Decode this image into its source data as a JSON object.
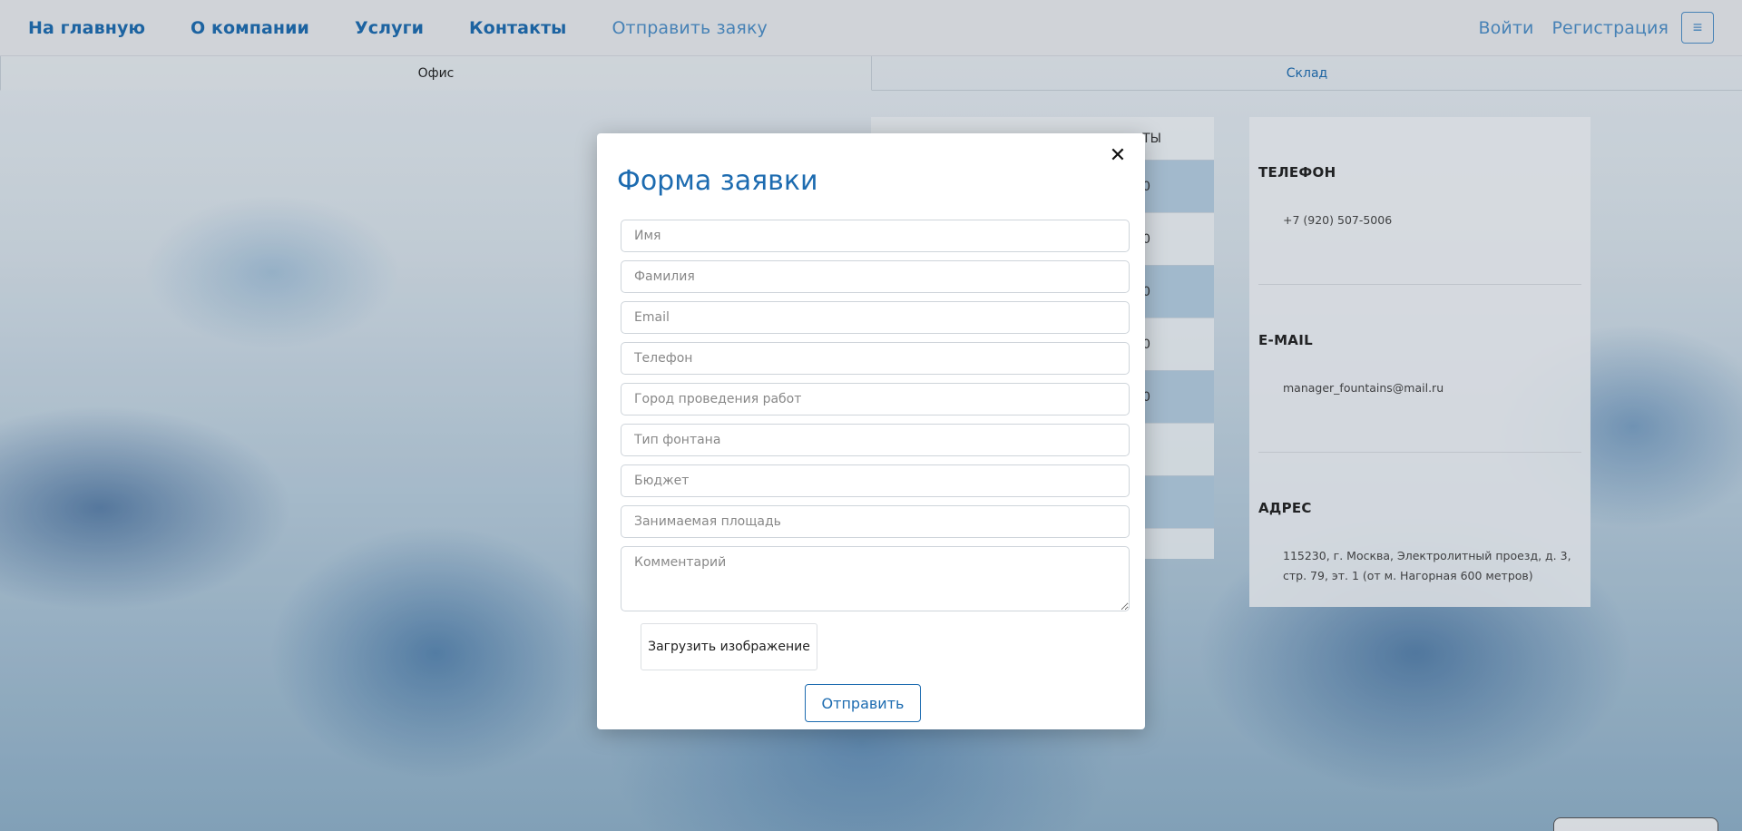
{
  "navbar": {
    "links": [
      "На главную",
      "О компании",
      "Услуги",
      "Контакты"
    ],
    "request_link": "Отправить заяку",
    "login": "Войти",
    "register": "Регистрация",
    "menu_icon": "≡"
  },
  "location_tabs": {
    "office": "Офис",
    "warehouse": "Склад"
  },
  "background_table": {
    "header_fragment": "ТЫ",
    "row_fragments": [
      "0",
      "0",
      "0",
      "0",
      "0",
      "",
      "",
      ""
    ]
  },
  "contacts": {
    "phone_heading": "ТЕЛЕФОН",
    "phone_value": "+7 (920) 507-5006",
    "email_heading": "E-MAIL",
    "email_value": "manager_fountains@mail.ru",
    "address_heading": "АДРЕС",
    "address_value": "115230, г. Москва, Электролитный проезд, д. 3, стр. 79, эт. 1 (от м. Нагорная 600 метров)"
  },
  "modal": {
    "title": "Форма заявки",
    "close_icon": "✕",
    "placeholders": {
      "first_name": "Имя",
      "last_name": "Фамилия",
      "email": "Email",
      "phone": "Телефон",
      "city": "Город проведения работ",
      "fountain_type": "Тип фонтана",
      "budget": "Бюджет",
      "area": "Занимаемая площадь",
      "comment": "Комментарий"
    },
    "upload_label": "Загрузить изображение",
    "submit_label": "Отправить"
  }
}
